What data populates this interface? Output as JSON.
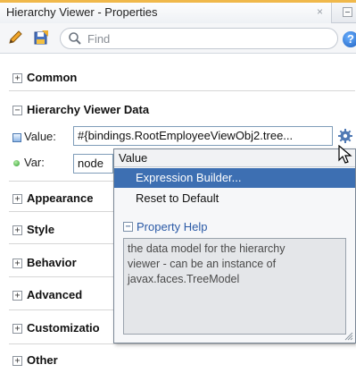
{
  "window": {
    "title": "Hierarchy Viewer - Properties",
    "close_glyph": "×"
  },
  "toolbar": {
    "search_placeholder": "Find",
    "help_glyph": "?"
  },
  "sections": {
    "common": "Common",
    "hierarchy_viewer_data": "Hierarchy Viewer Data",
    "appearance": "Appearance",
    "style": "Style",
    "behavior": "Behavior",
    "advanced": "Advanced",
    "customization": "Customizatio",
    "other": "Other"
  },
  "expander_glyphs": {
    "collapsed": "+",
    "expanded": "−"
  },
  "fields": {
    "value": {
      "label": "Value:",
      "text": "#{bindings.RootEmployeeViewObj2.tree..."
    },
    "var": {
      "label": "Var:",
      "text": "node"
    }
  },
  "popup": {
    "header": "Value",
    "items": [
      "Expression Builder...",
      "Reset to Default"
    ],
    "selected_index": 0,
    "property_help_title": "Property Help",
    "property_help_lines": [
      "the data model for the hierarchy",
      "viewer - can be an instance of",
      "javax.faces.TreeModel"
    ]
  },
  "colors": {
    "accent_title_bar": "#f0b84a",
    "menu_selected_bg": "#3d6fb2",
    "link_blue": "#2b5aa6"
  },
  "icons": [
    "pencil-icon",
    "save-icon",
    "search-icon",
    "help-icon",
    "gear-icon",
    "close-icon",
    "resize-grip-icon"
  ]
}
